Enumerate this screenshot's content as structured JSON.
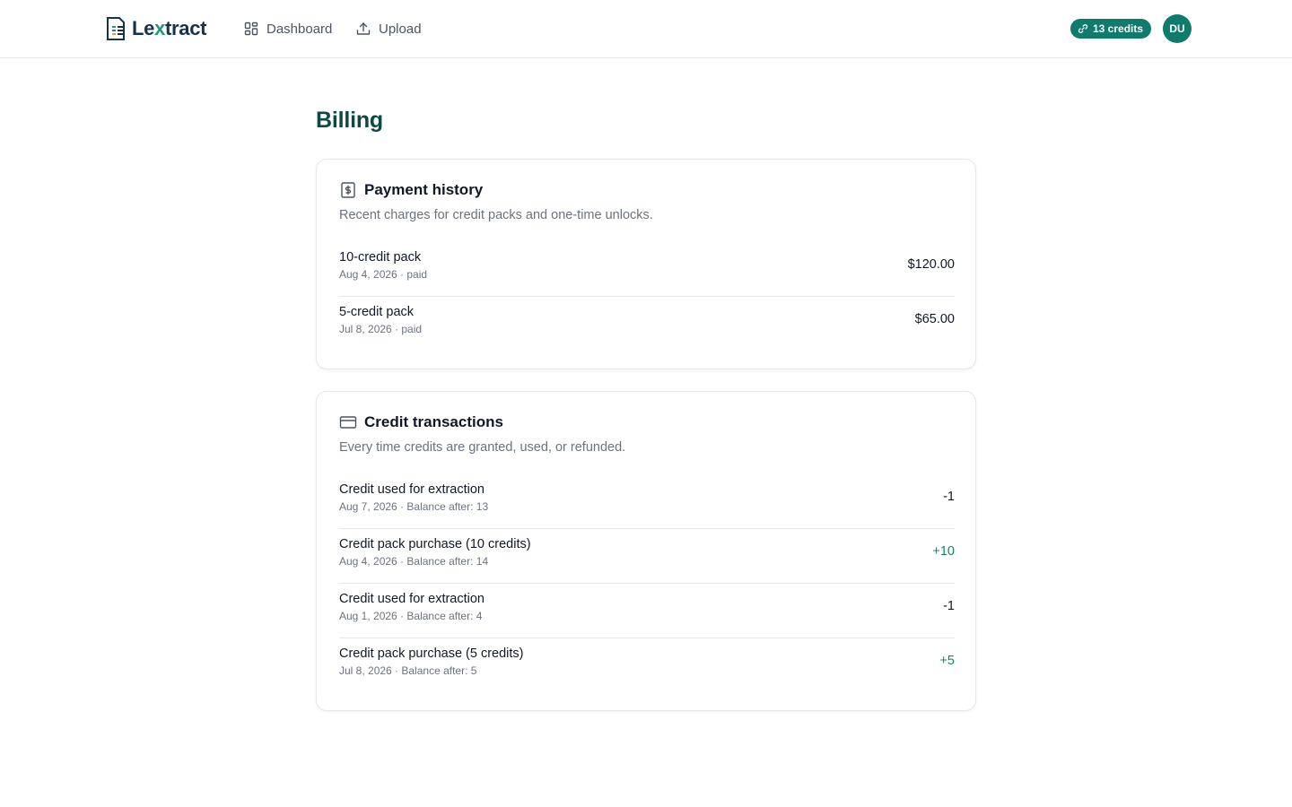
{
  "brand": {
    "name_prefix": "Le",
    "name_x": "x",
    "name_suffix": "tract"
  },
  "nav": [
    {
      "label": "Dashboard",
      "icon": "grid-icon"
    },
    {
      "label": "Upload",
      "icon": "upload-icon"
    }
  ],
  "header": {
    "credits_label": "13 credits",
    "avatar_initials": "DU"
  },
  "page": {
    "title": "Billing"
  },
  "payment_history": {
    "title": "Payment history",
    "description": "Recent charges for credit packs and one-time unlocks.",
    "icon": "receipt-dollar-icon",
    "rows": [
      {
        "title": "10-credit pack",
        "sub": "Aug 4, 2026 · paid",
        "amount": "$120.00"
      },
      {
        "title": "5-credit pack",
        "sub": "Jul 8, 2026 · paid",
        "amount": "$65.00"
      }
    ]
  },
  "credit_transactions": {
    "title": "Credit transactions",
    "description": "Every time credits are granted, used, or refunded.",
    "icon": "credit-card-icon",
    "rows": [
      {
        "title": "Credit used for extraction",
        "sub": "Aug 7, 2026 · Balance after: 13",
        "amount": "-1"
      },
      {
        "title": "Credit pack purchase (10 credits)",
        "sub": "Aug 4, 2026 · Balance after: 14",
        "amount": "+10"
      },
      {
        "title": "Credit used for extraction",
        "sub": "Aug 1, 2026 · Balance after: 4",
        "amount": "-1"
      },
      {
        "title": "Credit pack purchase (5 credits)",
        "sub": "Jul 8, 2026 · Balance after: 5",
        "amount": "+5"
      }
    ]
  },
  "colors": {
    "accent": "#0f7b6c",
    "title": "#0e4a43",
    "positive": "#0f8a5f"
  }
}
